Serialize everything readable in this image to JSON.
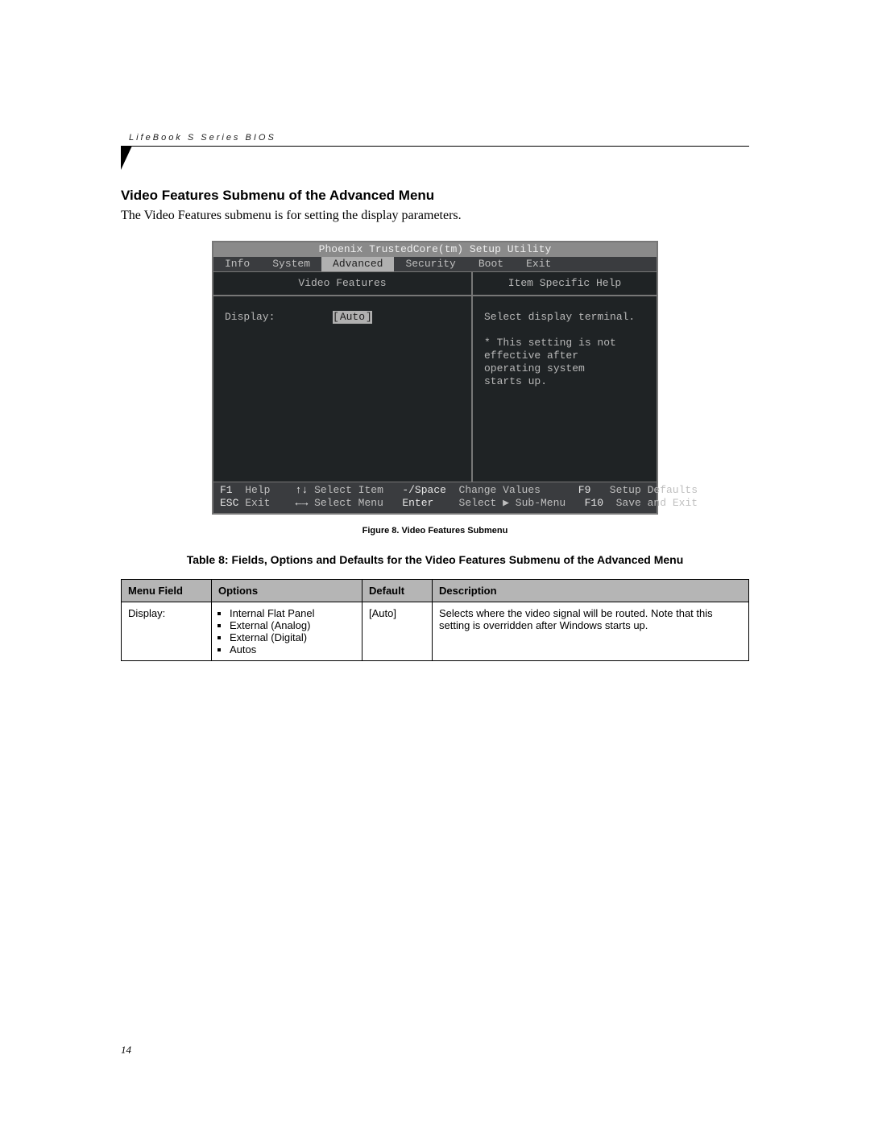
{
  "page": {
    "running_head": "LifeBook S Series BIOS",
    "section_title": "Video Features Submenu of the Advanced Menu",
    "intro": "The Video Features submenu is for setting the display parameters.",
    "figure_caption": "Figure 8.  Video Features Submenu",
    "table_caption": "Table 8: Fields, Options and Defaults for the Video Features Submenu of the Advanced Menu",
    "page_number": "14"
  },
  "bios": {
    "title": "Phoenix TrustedCore(tm) Setup Utility",
    "menu": [
      "Info",
      "System",
      "Advanced",
      "Security",
      "Boot",
      "Exit"
    ],
    "active_menu_index": 2,
    "left_title": "Video Features",
    "right_title": "Item Specific Help",
    "field_label": "Display:",
    "field_value": "Auto",
    "help_lines": [
      "Select display terminal.",
      "",
      "* This setting is not",
      "effective after",
      "operating system",
      "starts up."
    ],
    "footer": {
      "row1": {
        "k1": "F1",
        "a1": "Help",
        "k2": "↑↓",
        "a2": "Select Item",
        "k3": "-/Space",
        "a3": "Change Values",
        "k4": "F9",
        "a4": "Setup Defaults"
      },
      "row2": {
        "k1": "ESC",
        "a1": "Exit",
        "k2": "←→",
        "a2": "Select Menu",
        "k3": "Enter",
        "a3": "Select ▶ Sub-Menu",
        "k4": "F10",
        "a4": "Save and Exit"
      }
    }
  },
  "table": {
    "headers": [
      "Menu Field",
      "Options",
      "Default",
      "Description"
    ],
    "row": {
      "menu_field": "Display:",
      "options": [
        "Internal Flat Panel",
        "External (Analog)",
        "External (Digital)",
        "Autos"
      ],
      "default": "[Auto]",
      "description": "Selects where the video signal will be routed. Note that this setting is overridden after Windows starts up."
    }
  }
}
